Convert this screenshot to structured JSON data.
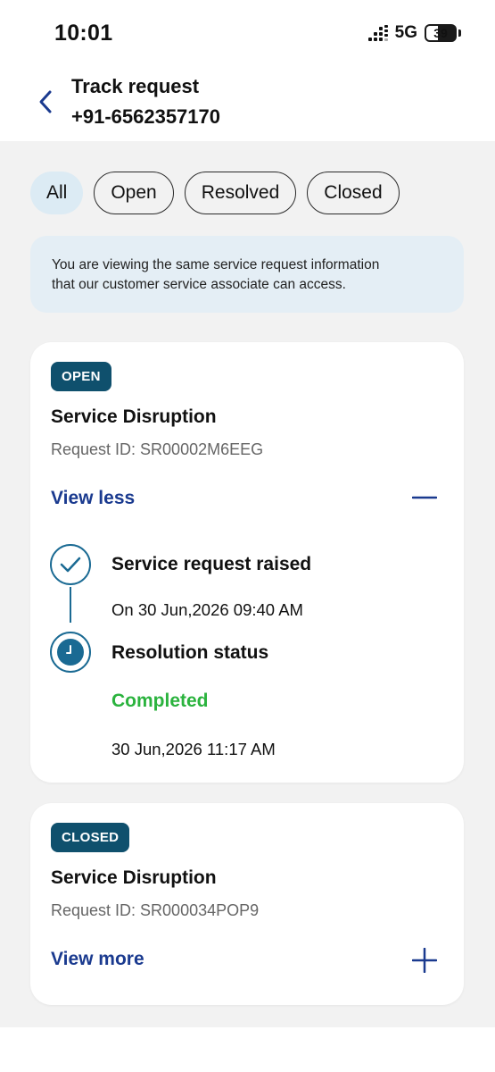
{
  "status_bar": {
    "time": "10:01",
    "network": "5G",
    "battery": "39"
  },
  "header": {
    "title": "Track request",
    "phone": "+91-6562357170",
    "back_icon": "chevron-left-icon"
  },
  "filters": [
    {
      "label": "All",
      "active": true
    },
    {
      "label": "Open",
      "active": false
    },
    {
      "label": "Resolved",
      "active": false
    },
    {
      "label": "Closed",
      "active": false
    }
  ],
  "info_banner": {
    "line1": "You are viewing the same service request information",
    "line2": "that our customer service associate can access."
  },
  "requests": [
    {
      "status": "OPEN",
      "title": "Service Disruption",
      "request_id": "Request ID: SR00002M6EEG",
      "toggle_label": "View less",
      "toggle_icon": "minus-icon",
      "timeline": {
        "step1_title": "Service request raised",
        "step1_date": "On 30 Jun,2026 09:40 AM",
        "step2_title": "Resolution status",
        "step2_status": "Completed",
        "step2_date": "30 Jun,2026 11:17 AM"
      }
    },
    {
      "status": "CLOSED",
      "title": "Service Disruption",
      "request_id": "Request ID: SR000034POP9",
      "toggle_label": "View more",
      "toggle_icon": "plus-icon"
    }
  ],
  "colors": {
    "badge": "#0f506d",
    "link": "#1a3a8f",
    "completed": "#2bb33e",
    "chip_active": "#dcebf4",
    "banner": "#e4eef5",
    "background": "#f2f2f2"
  }
}
